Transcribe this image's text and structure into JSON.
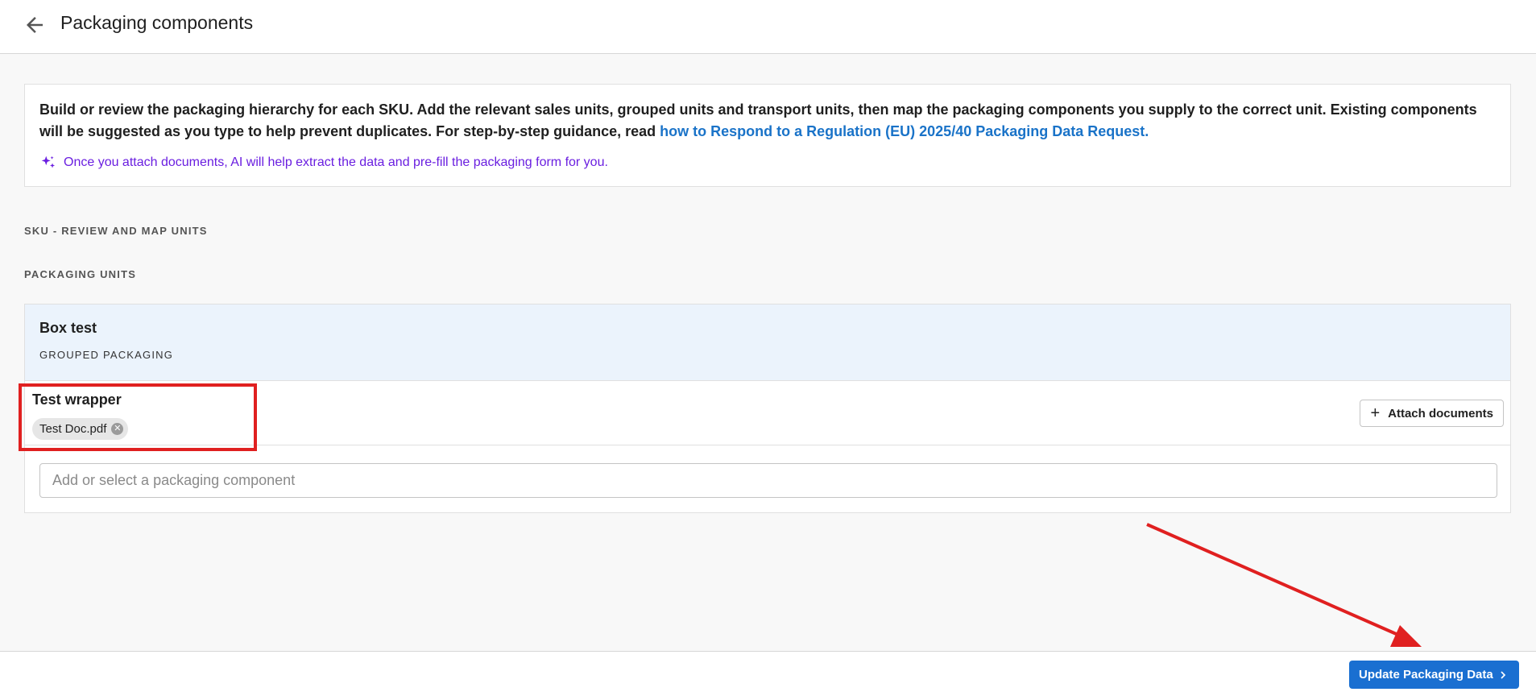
{
  "header": {
    "title": "Packaging components",
    "back_icon": "arrow-left-icon"
  },
  "info": {
    "text": "Build or review the packaging hierarchy for each SKU. Add the relevant sales units, grouped units and transport units, then map the packaging components you supply to the correct unit. Existing components will be suggested as you type to help prevent duplicates. For step-by-step guidance, read ",
    "link_text": "how to Respond to a Regulation (EU) 2025/40 Packaging Data Request.",
    "ai_icon": "sparkle-icon",
    "ai_text": "Once you attach documents, AI will help extract the data and pre-fill the packaging form for you."
  },
  "sections": {
    "sku_label": "SKU - REVIEW AND MAP UNITS",
    "packaging_units_label": "PACKAGING UNITS"
  },
  "unit": {
    "name": "Box test",
    "type": "GROUPED PACKAGING",
    "component": {
      "name": "Test wrapper",
      "document": "Test Doc.pdf",
      "remove_icon": "close-circle-icon"
    },
    "attach_label": "Attach documents",
    "input_placeholder": "Add or select a packaging component"
  },
  "footer": {
    "update_label": "Update Packaging Data",
    "chevron_icon": "chevron-right-icon"
  },
  "colors": {
    "primary": "#1a6fd1",
    "link": "#1a73c8",
    "ai": "#6a1ee0",
    "annotation": "#e02020",
    "unit_header_bg": "#ebf3fc"
  }
}
